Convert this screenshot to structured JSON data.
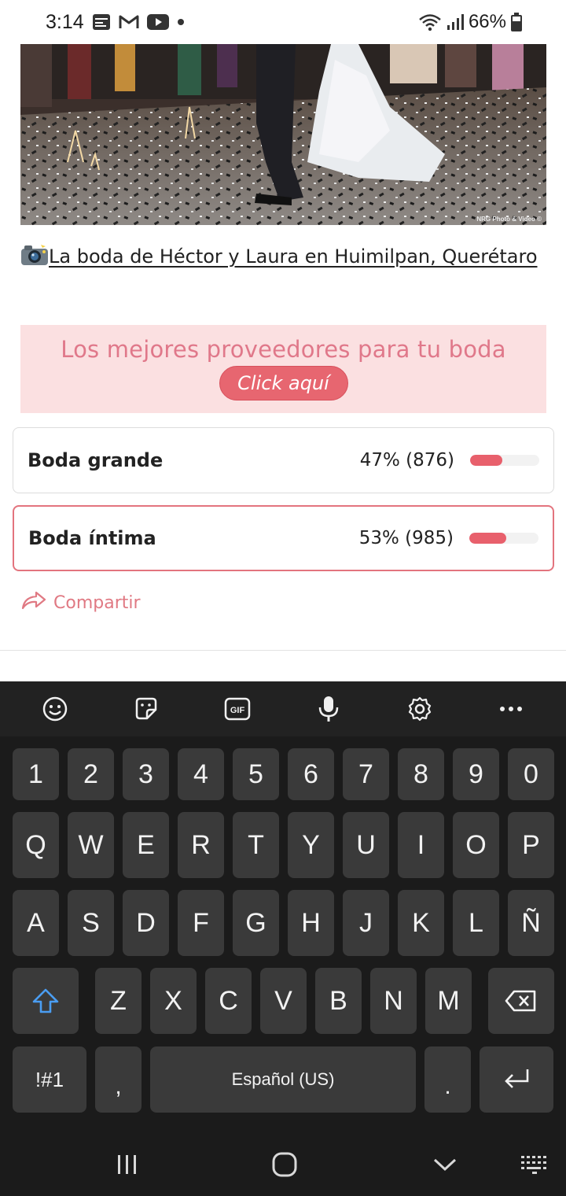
{
  "status_bar": {
    "time": "3:14",
    "battery": "66%"
  },
  "article": {
    "photo_credit": "NRG Photo & Video ©",
    "title": "La boda de Héctor y Laura en Huimilpan, Querétaro"
  },
  "banner": {
    "text": "Los mejores proveedores para tu boda",
    "button_label": "Click aquí"
  },
  "poll": {
    "options": [
      {
        "label": "Boda grande",
        "result": "47% (876)",
        "percent": 47,
        "selected": false
      },
      {
        "label": "Boda íntima",
        "result": "53% (985)",
        "percent": 53,
        "selected": true
      }
    ],
    "share_label": "Compartir"
  },
  "colors": {
    "accent": "#e8606c",
    "banner_bg": "#fbe0e1",
    "keyboard_bg": "#1b1b1b",
    "key_bg": "#3a3a3a"
  },
  "keyboard": {
    "toolbar": [
      "emoji-icon",
      "sticker-icon",
      "gif-icon",
      "microphone-icon",
      "gear-icon",
      "more-icon"
    ],
    "row_numbers": [
      "1",
      "2",
      "3",
      "4",
      "5",
      "6",
      "7",
      "8",
      "9",
      "0"
    ],
    "row_1": [
      "Q",
      "W",
      "E",
      "R",
      "T",
      "Y",
      "U",
      "I",
      "O",
      "P"
    ],
    "row_2": [
      "A",
      "S",
      "D",
      "F",
      "G",
      "H",
      "J",
      "K",
      "L",
      "Ñ"
    ],
    "row_3": [
      "Z",
      "X",
      "C",
      "V",
      "B",
      "N",
      "M"
    ],
    "symbols_label": "!#1",
    "comma": ",",
    "space_label": "Español (US)",
    "period": "."
  },
  "nav_bar": [
    "recents-icon",
    "home-icon",
    "back-icon",
    "keyboard-switch-icon"
  ]
}
